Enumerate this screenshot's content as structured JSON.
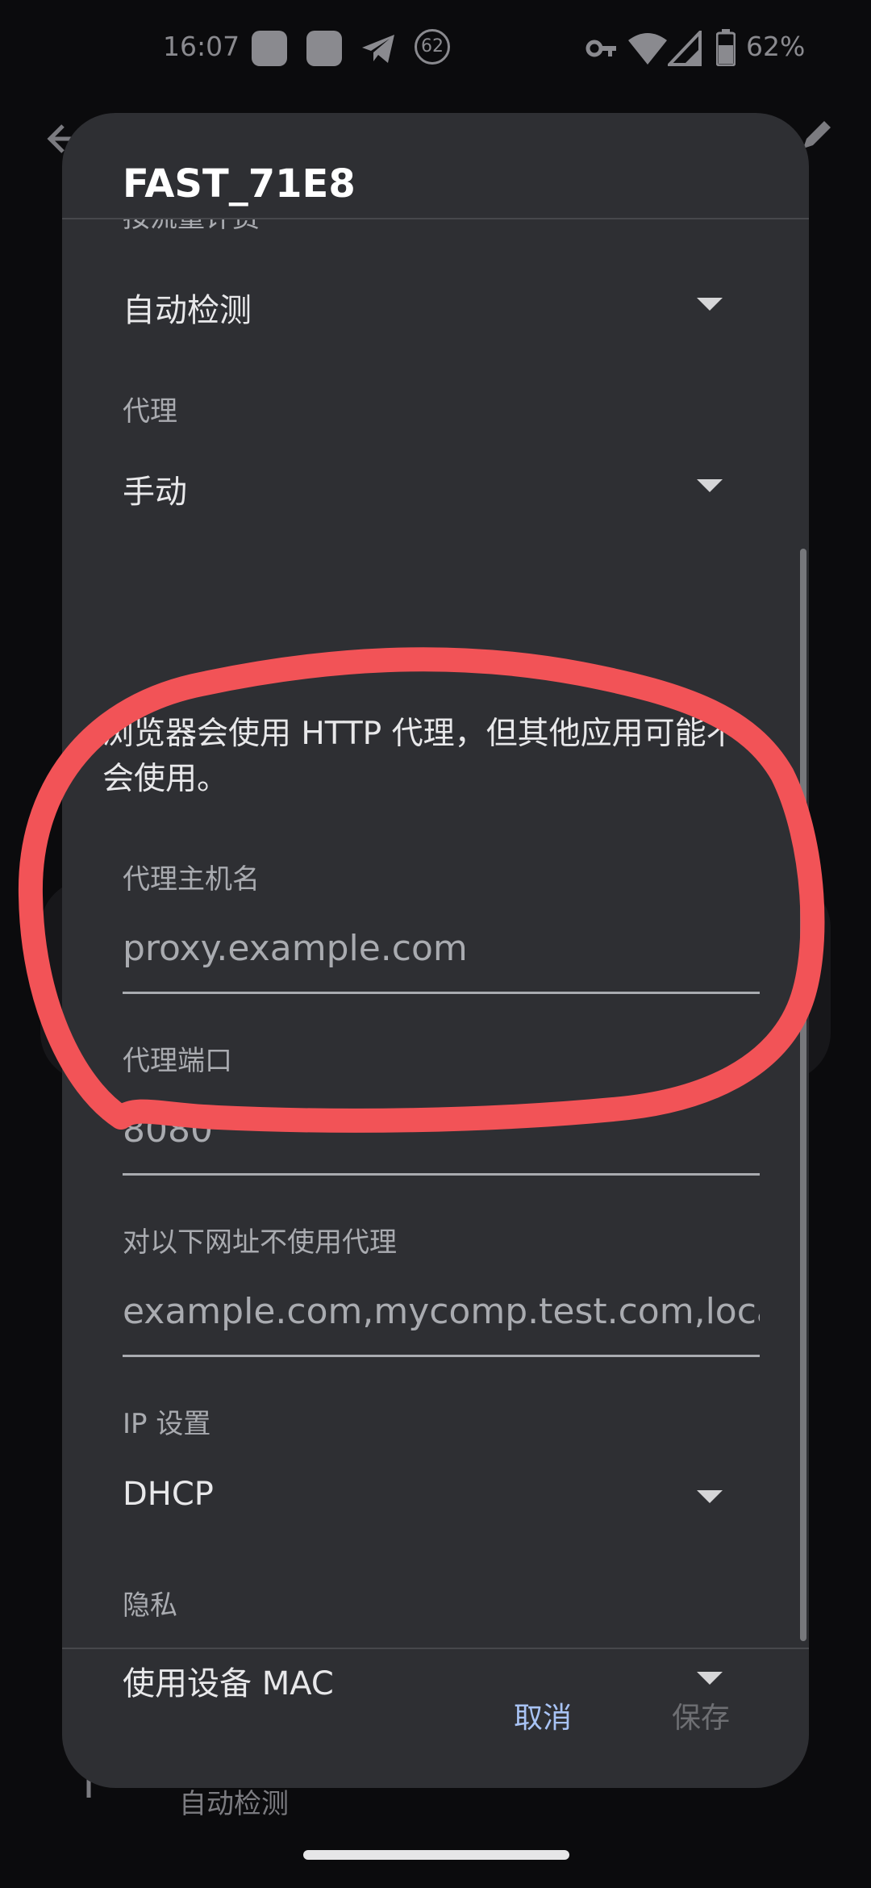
{
  "status_bar": {
    "time": "16:07",
    "notification_badge": "62",
    "battery": "62%"
  },
  "background": {
    "text": "自动检测",
    "icons": [
      "back-arrow-icon",
      "edit-pencil-icon"
    ]
  },
  "dialog": {
    "title": "FAST_71E8",
    "metered": {
      "label": "按流量计费",
      "value": "自动检测"
    },
    "proxy": {
      "label": "代理",
      "value": "手动"
    },
    "note": "浏览器会使用 HTTP 代理，但其他应用可能不会使用。",
    "proxy_host": {
      "label": "代理主机名",
      "placeholder": "proxy.example.com"
    },
    "proxy_port": {
      "label": "代理端口",
      "placeholder": "8080"
    },
    "bypass": {
      "label": "对以下网址不使用代理",
      "placeholder": "example.com,mycomp.test.com,localhost"
    },
    "ip_settings": {
      "label": "IP 设置",
      "value": "DHCP"
    },
    "privacy": {
      "label": "隐私",
      "value": "使用设备 MAC"
    },
    "buttons": {
      "cancel": "取消",
      "save": "保存"
    }
  },
  "colors": {
    "dialog_bg": "#2e2f33",
    "accent": "#a8c3f5",
    "annotation": "#f25357"
  }
}
